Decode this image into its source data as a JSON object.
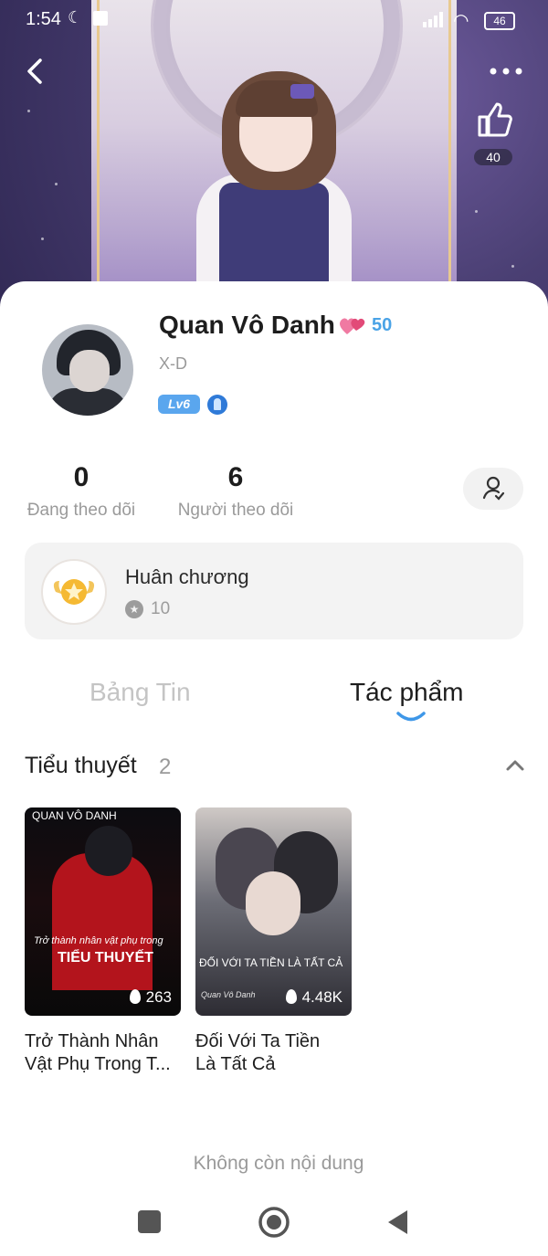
{
  "status_bar": {
    "time": "1:54",
    "battery": "46"
  },
  "profile": {
    "name": "Quan Vô Danh",
    "hearts": "50",
    "user_id": "X-D",
    "level": "Lv6",
    "following_count": "0",
    "following_label": "Đang theo dõi",
    "followers_count": "6",
    "followers_label": "Người theo dõi",
    "likes": "40"
  },
  "medal": {
    "title": "Huân chương",
    "count": "10"
  },
  "tabs": {
    "news": "Bảng Tin",
    "works": "Tác phẩm"
  },
  "section": {
    "title": "Tiểu thuyết",
    "count": "2"
  },
  "books": [
    {
      "title_line1": "Trở Thành Nhân",
      "title_line2": "Vật Phụ Trong T...",
      "heat": "263",
      "cover_author": "QUAN VÔ DANH",
      "cover_text1": "Trở thành nhân vật phụ trong",
      "cover_text2": "TIỂU THUYẾT"
    },
    {
      "title_line1": "Đối Với Ta Tiền",
      "title_line2": "Là Tất Cả",
      "heat": "4.48K",
      "cover_text1": "ĐỐI VỚI TA TIỀN LÀ TẤT CẢ",
      "cover_author": "Quan Vô Danh"
    }
  ],
  "footer": {
    "end_text": "Không còn nội dung"
  }
}
